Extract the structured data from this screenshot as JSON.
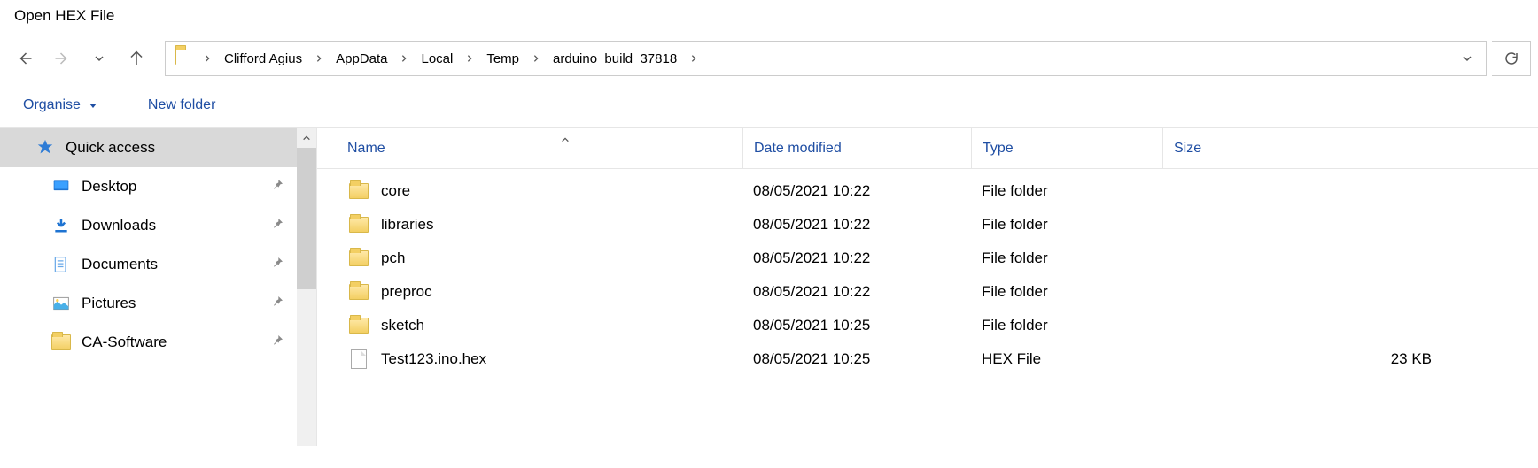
{
  "window": {
    "title": "Open HEX File"
  },
  "nav": {},
  "breadcrumb": {
    "items": [
      {
        "label": "Clifford Agius"
      },
      {
        "label": "AppData"
      },
      {
        "label": "Local"
      },
      {
        "label": "Temp"
      },
      {
        "label": "arduino_build_37818"
      }
    ]
  },
  "toolbar": {
    "organise_label": "Organise",
    "newfolder_label": "New folder"
  },
  "sidebar": {
    "quick_access_label": "Quick access",
    "items": [
      {
        "label": "Desktop",
        "icon": "desktop"
      },
      {
        "label": "Downloads",
        "icon": "downloads"
      },
      {
        "label": "Documents",
        "icon": "documents"
      },
      {
        "label": "Pictures",
        "icon": "pictures"
      },
      {
        "label": "CA-Software",
        "icon": "folder"
      }
    ]
  },
  "columns": {
    "name": "Name",
    "date": "Date modified",
    "type": "Type",
    "size": "Size"
  },
  "files": [
    {
      "name": "core",
      "date": "08/05/2021 10:22",
      "type": "File folder",
      "size": "",
      "kind": "folder"
    },
    {
      "name": "libraries",
      "date": "08/05/2021 10:22",
      "type": "File folder",
      "size": "",
      "kind": "folder"
    },
    {
      "name": "pch",
      "date": "08/05/2021 10:22",
      "type": "File folder",
      "size": "",
      "kind": "folder"
    },
    {
      "name": "preproc",
      "date": "08/05/2021 10:22",
      "type": "File folder",
      "size": "",
      "kind": "folder"
    },
    {
      "name": "sketch",
      "date": "08/05/2021 10:25",
      "type": "File folder",
      "size": "",
      "kind": "folder"
    },
    {
      "name": "Test123.ino.hex",
      "date": "08/05/2021 10:25",
      "type": "HEX File",
      "size": "23 KB",
      "kind": "file"
    }
  ]
}
